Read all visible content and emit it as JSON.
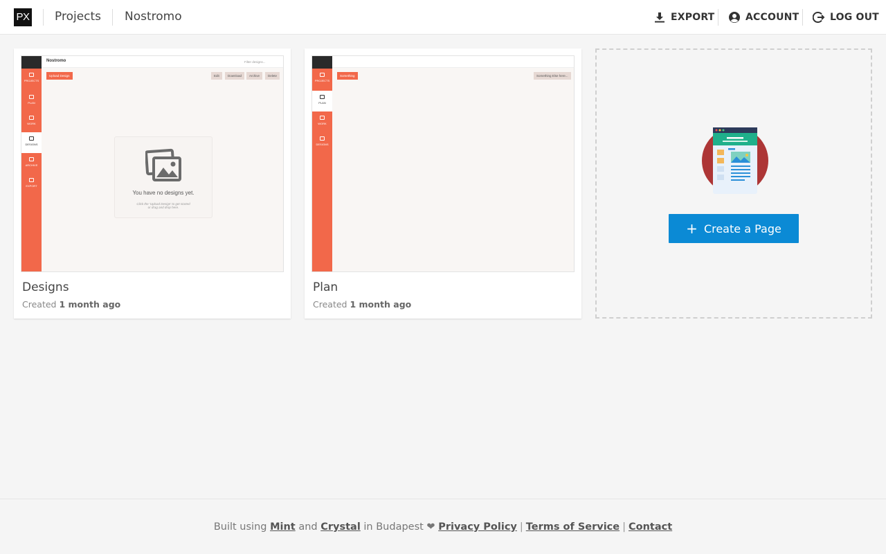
{
  "header": {
    "logo_text": "PX",
    "breadcrumb": {
      "projects": "Projects",
      "project": "Nostromo"
    },
    "actions": {
      "export": "EXPORT",
      "account": "ACCOUNT",
      "logout": "LOG OUT"
    }
  },
  "pages": [
    {
      "title": "Designs",
      "created_prefix": "Created",
      "created_ago": "1 month ago",
      "preview": {
        "app_title": "Nostromo",
        "search_placeholder": "Filter designs...",
        "primary_action": "Upload Design",
        "actions": [
          "Edit",
          "Download",
          "Archive",
          "Delete"
        ],
        "nav": [
          "PROJECTS",
          "PLAN",
          "WORK",
          "DESIGNS",
          "ARCHIVE",
          "EXPORT"
        ],
        "active_nav": "DESIGNS",
        "empty_title": "You have no designs yet.",
        "empty_hint_1": "Click the 'Upload Design' to get started",
        "empty_hint_2": "or drag and drop here."
      }
    },
    {
      "title": "Plan",
      "created_prefix": "Created",
      "created_ago": "1 month ago",
      "preview": {
        "primary_action": "Something",
        "secondary_action": "Something Else here...",
        "nav": [
          "PROJECTS",
          "PLAN",
          "WORK",
          "DESIGNS"
        ],
        "active_nav": "PLAN"
      }
    }
  ],
  "create": {
    "label": "Create a Page",
    "icon": "plus-icon"
  },
  "footer": {
    "built_using": "Built using",
    "mint": "Mint",
    "and": "and",
    "crystal": "Crystal",
    "in_budapest": "in Budapest ❤",
    "privacy": "Privacy Policy",
    "terms": "Terms of Service",
    "contact": "Contact"
  },
  "colors": {
    "accent": "#0b8ad5",
    "preview_sidebar": "#f2684a"
  }
}
